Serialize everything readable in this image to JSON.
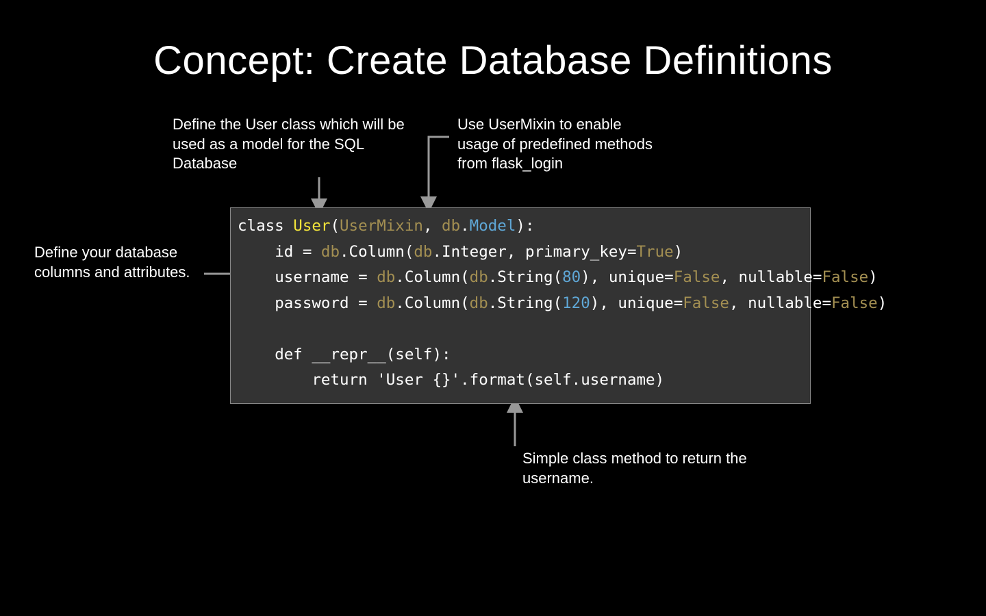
{
  "title": "Concept: Create Database Definitions",
  "annotations": {
    "top_left": "Define the User class which will be used as a model for the SQL Database",
    "top_right": "Use UserMixin to enable usage of predefined methods from flask_login",
    "left": "Define your database columns and attributes.",
    "bottom": "Simple class method to return the username."
  },
  "code": {
    "line1": {
      "kw_class": "class",
      "User": "User",
      "open": "(",
      "UserMixin": "UserMixin",
      "comma1": ", ",
      "db": "db",
      "dot1": ".",
      "Model": "Model",
      "close": "):"
    },
    "line2": {
      "indent": "    ",
      "id": "id = ",
      "db": "db",
      "rest": ".Column(",
      "db2": "db",
      "rest2": ".Integer, primary_key=",
      "true": "True",
      "end": ")"
    },
    "line3": {
      "indent": "    ",
      "username": "username = ",
      "db": "db",
      "rest": ".Column(",
      "db2": "db",
      "rest2": ".String(",
      "num": "80",
      "rest3": "), unique=",
      "false1": "False",
      "rest4": ", nullable=",
      "false2": "False",
      "end": ")"
    },
    "line4": {
      "indent": "    ",
      "password": "password = ",
      "db": "db",
      "rest": ".Column(",
      "db2": "db",
      "rest2": ".String(",
      "num": "120",
      "rest3": "), unique=",
      "false1": "False",
      "rest4": ", nullable=",
      "false2": "False",
      "end": ")"
    },
    "line5": " ",
    "line6": {
      "indent": "    ",
      "def": "def",
      "sp": " ",
      "name": "__repr__",
      "args": "(self):"
    },
    "line7": {
      "indent": "        ",
      "ret": "return",
      "sp": " ",
      "str": "'User {}'",
      "rest": ".format(self.username)"
    }
  }
}
